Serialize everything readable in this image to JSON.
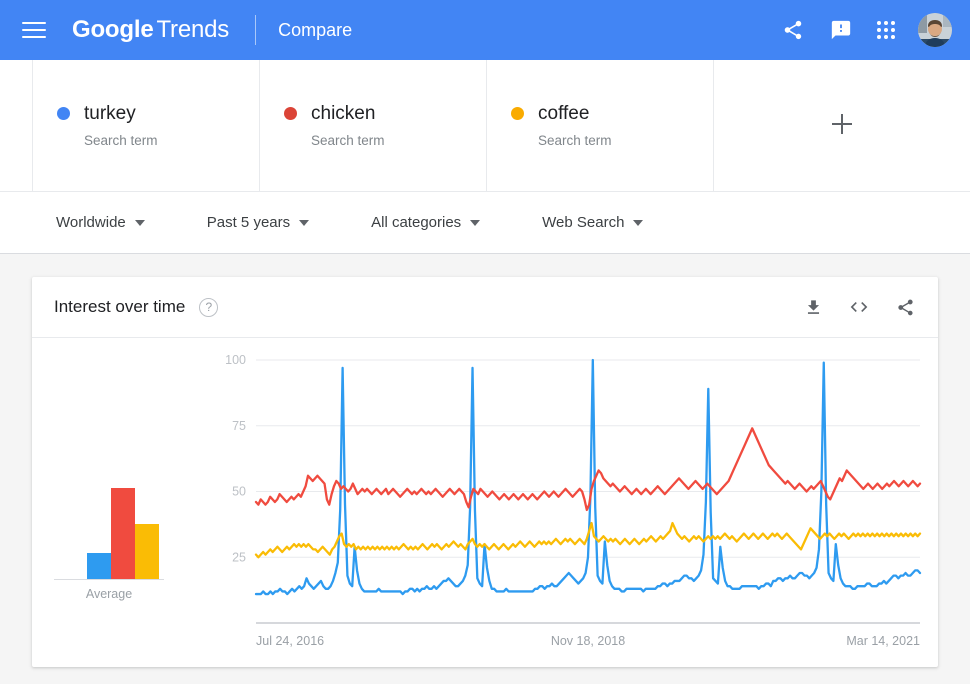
{
  "header": {
    "menu_icon": "hamburger-icon",
    "brand_google": "Google",
    "brand_trends": "Trends",
    "section": "Compare",
    "share_icon": "share-icon",
    "feedback_icon": "feedback-icon",
    "apps_icon": "apps-grid-icon",
    "avatar": "user-avatar",
    "background": "#4285f4"
  },
  "terms": [
    {
      "name": "turkey",
      "type": "Search term",
      "color": "#4285f4"
    },
    {
      "name": "chicken",
      "type": "Search term",
      "color": "#db4437"
    },
    {
      "name": "coffee",
      "type": "Search term",
      "color": "#f9ab00"
    }
  ],
  "add_term_label": "+",
  "filters": [
    {
      "label": "Worldwide"
    },
    {
      "label": "Past 5 years"
    },
    {
      "label": "All categories"
    },
    {
      "label": "Web Search"
    }
  ],
  "panel": {
    "title": "Interest over time",
    "help_icon": "help-circle-icon",
    "help_glyph": "?",
    "download_icon": "download-icon",
    "embed_icon": "embed-code-icon",
    "embed_glyph": "< >",
    "share_icon": "share-icon"
  },
  "chart_data": {
    "type": "line",
    "title": "Interest over time",
    "xlabel": "",
    "ylabel": "",
    "ylim": [
      0,
      100
    ],
    "yticks": [
      100,
      75,
      50,
      25
    ],
    "grid": true,
    "legend": "none",
    "x_tick_labels": [
      "Jul 24, 2016",
      "Nov 18, 2018",
      "Mar 14, 2021"
    ],
    "x_tick_positions": [
      0.0,
      0.5,
      1.0
    ],
    "series": [
      {
        "name": "turkey",
        "color": "#2e9bf0",
        "values": [
          11,
          11,
          11,
          12,
          11,
          11,
          12,
          11,
          12,
          12,
          13,
          12,
          12,
          11,
          12,
          13,
          12,
          13,
          14,
          13,
          14,
          17,
          15,
          14,
          13,
          14,
          15,
          16,
          14,
          13,
          13,
          14,
          16,
          19,
          23,
          43,
          97,
          45,
          18,
          15,
          14,
          29,
          20,
          15,
          13,
          12,
          12,
          12,
          12,
          12,
          12,
          13,
          12,
          12,
          12,
          12,
          12,
          12,
          12,
          12,
          12,
          11,
          12,
          12,
          13,
          13,
          12,
          13,
          12,
          13,
          13,
          14,
          13,
          13,
          14,
          13,
          14,
          15,
          16,
          16,
          17,
          16,
          15,
          14,
          14,
          15,
          16,
          18,
          22,
          44,
          97,
          43,
          17,
          15,
          14,
          30,
          21,
          16,
          13,
          13,
          12,
          12,
          12,
          12,
          13,
          12,
          12,
          12,
          12,
          12,
          12,
          12,
          12,
          12,
          12,
          12,
          13,
          13,
          14,
          14,
          13,
          14,
          14,
          15,
          14,
          14,
          15,
          16,
          17,
          18,
          19,
          18,
          17,
          16,
          15,
          16,
          17,
          19,
          25,
          48,
          100,
          44,
          18,
          16,
          15,
          31,
          22,
          16,
          14,
          13,
          13,
          13,
          12,
          12,
          13,
          13,
          13,
          13,
          13,
          13,
          13,
          12,
          13,
          13,
          13,
          13,
          13,
          14,
          14,
          15,
          15,
          14,
          15,
          15,
          16,
          16,
          16,
          17,
          18,
          18,
          17,
          17,
          16,
          17,
          18,
          20,
          26,
          46,
          89,
          42,
          17,
          16,
          15,
          29,
          21,
          16,
          14,
          14,
          13,
          13,
          13,
          13,
          14,
          14,
          14,
          14,
          14,
          14,
          14,
          13,
          14,
          14,
          15,
          15,
          14,
          16,
          16,
          17,
          17,
          16,
          17,
          17,
          18,
          17,
          17,
          18,
          19,
          19,
          18,
          18,
          17,
          18,
          19,
          21,
          28,
          50,
          99,
          45,
          19,
          17,
          16,
          30,
          22,
          17,
          15,
          14,
          14,
          14,
          13,
          13,
          14,
          14,
          14,
          14,
          15,
          15,
          14,
          14,
          14,
          15,
          15,
          16,
          15,
          16,
          17,
          18,
          18,
          17,
          18,
          18,
          19,
          18,
          18,
          19,
          20,
          20,
          19
        ]
      },
      {
        "name": "chicken",
        "color": "#f04b3f",
        "values": [
          46,
          45,
          47,
          46,
          45,
          46,
          48,
          47,
          46,
          47,
          49,
          48,
          47,
          46,
          47,
          48,
          47,
          48,
          49,
          48,
          50,
          52,
          56,
          55,
          54,
          55,
          56,
          55,
          54,
          53,
          47,
          45,
          49,
          52,
          54,
          53,
          51,
          52,
          51,
          50,
          51,
          53,
          51,
          49,
          50,
          51,
          50,
          51,
          50,
          49,
          50,
          51,
          50,
          49,
          50,
          51,
          49,
          50,
          51,
          50,
          49,
          48,
          49,
          50,
          51,
          50,
          49,
          50,
          49,
          50,
          51,
          50,
          49,
          50,
          49,
          50,
          51,
          50,
          49,
          48,
          49,
          50,
          51,
          50,
          49,
          50,
          51,
          50,
          49,
          46,
          44,
          48,
          51,
          50,
          49,
          51,
          50,
          49,
          48,
          49,
          50,
          49,
          48,
          47,
          48,
          49,
          48,
          47,
          48,
          49,
          48,
          47,
          48,
          49,
          48,
          47,
          48,
          49,
          48,
          47,
          48,
          49,
          50,
          49,
          48,
          49,
          50,
          49,
          48,
          49,
          50,
          51,
          50,
          49,
          48,
          49,
          50,
          51,
          50,
          47,
          43,
          45,
          51,
          54,
          56,
          58,
          57,
          55,
          54,
          53,
          52,
          53,
          52,
          51,
          50,
          51,
          52,
          51,
          50,
          49,
          50,
          51,
          50,
          49,
          50,
          51,
          50,
          49,
          50,
          51,
          52,
          51,
          50,
          49,
          50,
          51,
          52,
          53,
          54,
          55,
          54,
          53,
          52,
          51,
          52,
          53,
          54,
          53,
          52,
          51,
          52,
          53,
          52,
          51,
          50,
          49,
          50,
          51,
          52,
          53,
          54,
          56,
          58,
          60,
          62,
          64,
          66,
          68,
          70,
          72,
          74,
          72,
          70,
          68,
          66,
          64,
          62,
          60,
          59,
          58,
          57,
          56,
          55,
          54,
          53,
          54,
          53,
          52,
          51,
          52,
          53,
          52,
          51,
          50,
          51,
          52,
          51,
          52,
          53,
          54,
          52,
          50,
          48,
          47,
          49,
          51,
          53,
          55,
          54,
          56,
          58,
          57,
          56,
          55,
          54,
          53,
          52,
          51,
          52,
          53,
          52,
          51,
          52,
          53,
          52,
          51,
          52,
          53,
          52,
          53,
          54,
          53,
          52,
          53,
          54,
          53,
          52,
          53,
          54,
          53,
          52,
          53
        ]
      },
      {
        "name": "coffee",
        "color": "#fabc05",
        "values": [
          26,
          25,
          26,
          27,
          26,
          27,
          28,
          27,
          28,
          29,
          28,
          27,
          28,
          29,
          28,
          29,
          30,
          29,
          30,
          29,
          30,
          29,
          30,
          29,
          28,
          28,
          27,
          28,
          29,
          28,
          27,
          26,
          28,
          29,
          31,
          33,
          34,
          30,
          29,
          30,
          29,
          30,
          28,
          29,
          28,
          29,
          28,
          29,
          28,
          29,
          28,
          29,
          28,
          29,
          28,
          29,
          28,
          29,
          28,
          29,
          28,
          29,
          30,
          29,
          28,
          29,
          28,
          29,
          28,
          29,
          30,
          29,
          28,
          29,
          30,
          29,
          30,
          29,
          28,
          29,
          30,
          29,
          30,
          31,
          30,
          29,
          30,
          29,
          28,
          30,
          31,
          32,
          30,
          29,
          30,
          29,
          30,
          29,
          28,
          29,
          30,
          29,
          28,
          29,
          30,
          29,
          28,
          29,
          30,
          29,
          30,
          31,
          30,
          29,
          30,
          31,
          30,
          29,
          30,
          31,
          30,
          31,
          30,
          31,
          30,
          31,
          32,
          31,
          30,
          31,
          32,
          31,
          32,
          31,
          30,
          31,
          32,
          31,
          30,
          32,
          35,
          38,
          33,
          32,
          31,
          32,
          33,
          32,
          31,
          32,
          31,
          32,
          31,
          30,
          31,
          32,
          31,
          30,
          31,
          32,
          31,
          30,
          31,
          32,
          31,
          32,
          33,
          32,
          31,
          32,
          33,
          32,
          33,
          34,
          35,
          38,
          36,
          34,
          33,
          32,
          33,
          32,
          31,
          32,
          33,
          32,
          33,
          32,
          31,
          32,
          33,
          32,
          33,
          32,
          33,
          32,
          33,
          34,
          33,
          32,
          33,
          32,
          31,
          32,
          33,
          34,
          33,
          32,
          33,
          34,
          33,
          32,
          33,
          34,
          33,
          32,
          33,
          34,
          33,
          34,
          33,
          32,
          33,
          34,
          33,
          32,
          31,
          30,
          29,
          28,
          30,
          32,
          34,
          36,
          35,
          34,
          33,
          32,
          33,
          34,
          33,
          34,
          33,
          32,
          33,
          34,
          33,
          34,
          33,
          32,
          33,
          34,
          33,
          34,
          33,
          34,
          33,
          34,
          33,
          34,
          33,
          34,
          33,
          34,
          33,
          34,
          33,
          34,
          33,
          34,
          33,
          34,
          33,
          34,
          33,
          34,
          33,
          34,
          33,
          34
        ]
      }
    ],
    "average_chart": {
      "type": "bar",
      "caption": "Average",
      "categories": [
        "turkey",
        "chicken",
        "coffee"
      ],
      "values": [
        14,
        49,
        30
      ],
      "colors": [
        "#2e9bf0",
        "#f04b3f",
        "#fabc05"
      ]
    }
  }
}
